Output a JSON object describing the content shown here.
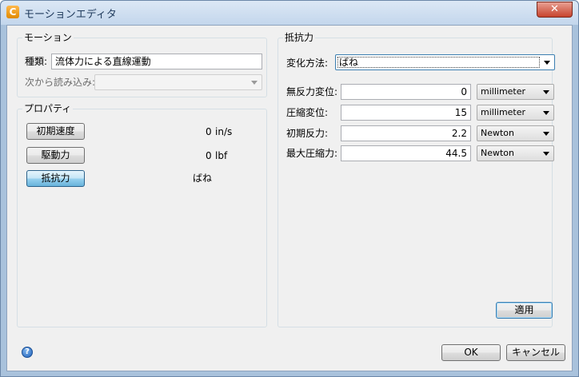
{
  "window": {
    "title": "モーションエディタ",
    "app_icon_glyph": "C",
    "close_glyph": "✕"
  },
  "motion": {
    "group_label": "モーション",
    "type_label": "種類:",
    "type_value": "流体力による直線運動",
    "load_from_label": "次から読み込み:",
    "load_from_value": ""
  },
  "properties": {
    "group_label": "プロパティ",
    "rows": [
      {
        "button": "初期速度",
        "value": "0",
        "unit": "in/s"
      },
      {
        "button": "駆動力",
        "value": "0",
        "unit": "lbf"
      },
      {
        "button": "抵抗力",
        "value": "ばね",
        "unit": ""
      }
    ]
  },
  "resistance": {
    "group_label": "抵抗力",
    "method_label": "変化方法:",
    "method_value": "ばね",
    "fields": [
      {
        "label": "無反力変位:",
        "value": "0",
        "unit": "millimeter"
      },
      {
        "label": "圧縮変位:",
        "value": "15",
        "unit": "millimeter"
      },
      {
        "label": "初期反力:",
        "value": "2.2",
        "unit": "Newton"
      },
      {
        "label": "最大圧縮力:",
        "value": "44.5",
        "unit": "Newton"
      }
    ],
    "apply_label": "適用"
  },
  "footer": {
    "help_glyph": "?",
    "ok_label": "OK",
    "cancel_label": "キャンセル"
  }
}
